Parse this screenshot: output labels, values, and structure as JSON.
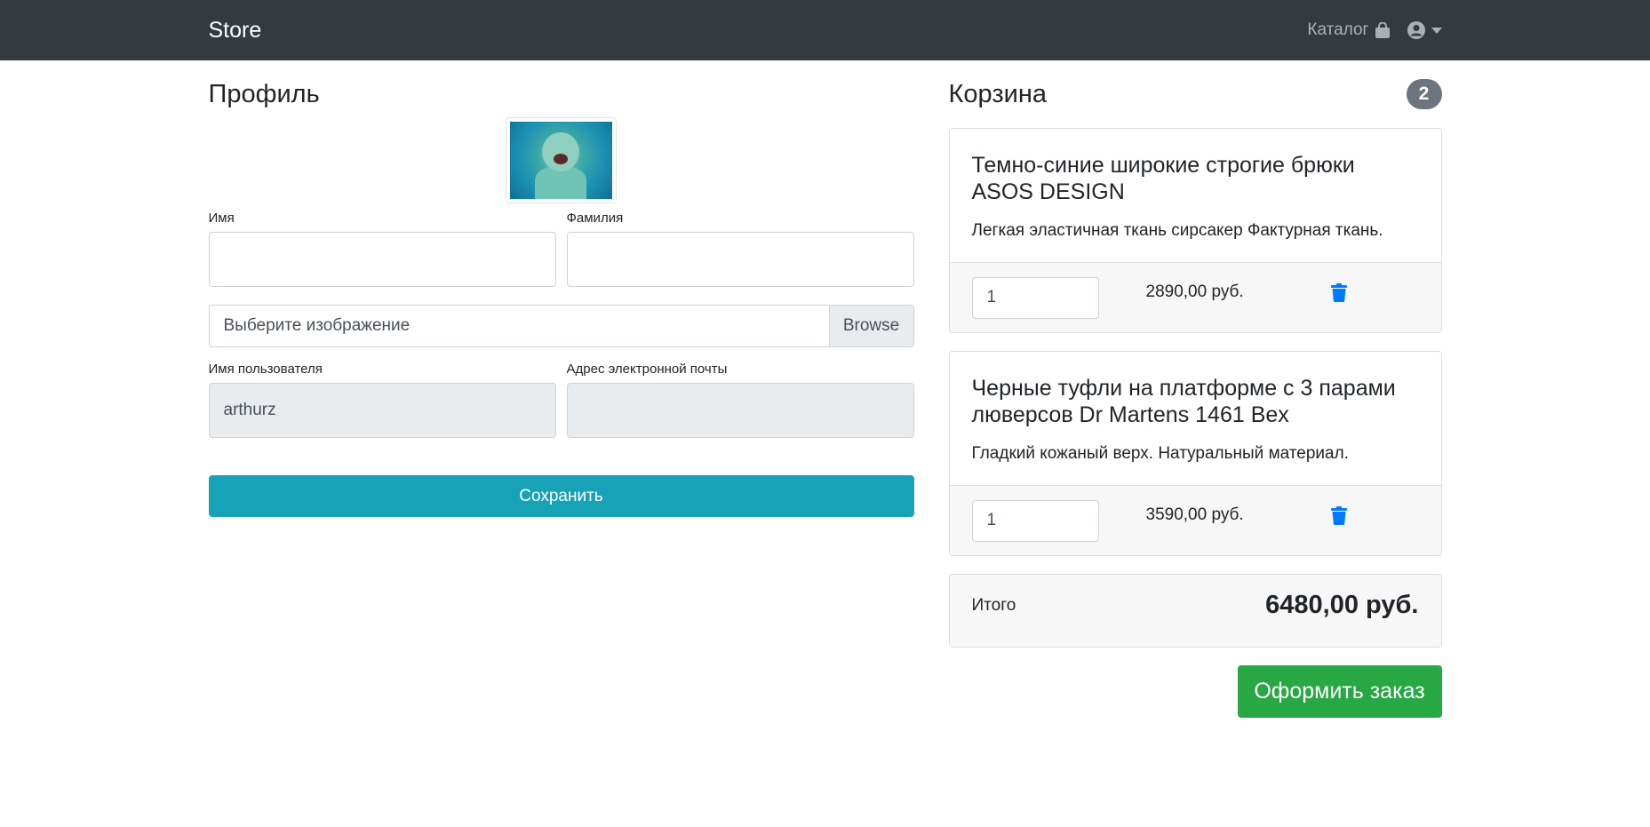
{
  "navbar": {
    "brand": "Store",
    "catalog_label": "Каталог",
    "catalog_icon": "shopping-bag-icon",
    "user_icon": "user-circle-icon",
    "dropdown_icon": "caret-down-icon"
  },
  "profile": {
    "title": "Профиль",
    "avatar_alt": "avatar",
    "first_name": {
      "label": "Имя",
      "value": ""
    },
    "last_name": {
      "label": "Фамилия",
      "value": ""
    },
    "file": {
      "placeholder": "Выберите изображение",
      "browse_label": "Browse"
    },
    "username": {
      "label": "Имя пользователя",
      "value": "arthurz"
    },
    "email": {
      "label": "Адрес электронной почты",
      "value": ""
    },
    "save_label": "Сохранить"
  },
  "cart": {
    "title": "Корзина",
    "count": "2",
    "items": [
      {
        "title": "Темно-синие широкие строгие брюки ASOS DESIGN",
        "description": "Легкая эластичная ткань сирсакер Фактурная ткань.",
        "quantity": "1",
        "price": "2890,00 руб."
      },
      {
        "title": "Черные туфли на платформе с 3 парами люверсов Dr Martens 1461 Bex",
        "description": "Гладкий кожаный верх. Натуральный материал.",
        "quantity": "1",
        "price": "3590,00 руб."
      }
    ],
    "total_label": "Итого",
    "total_value": "6480,00 руб.",
    "order_label": "Оформить заказ"
  },
  "colors": {
    "navbar_bg": "#343a40",
    "save_button": "#17a2b8",
    "order_button": "#28a745",
    "trash_icon": "#007bff",
    "badge": "#6c757d"
  }
}
